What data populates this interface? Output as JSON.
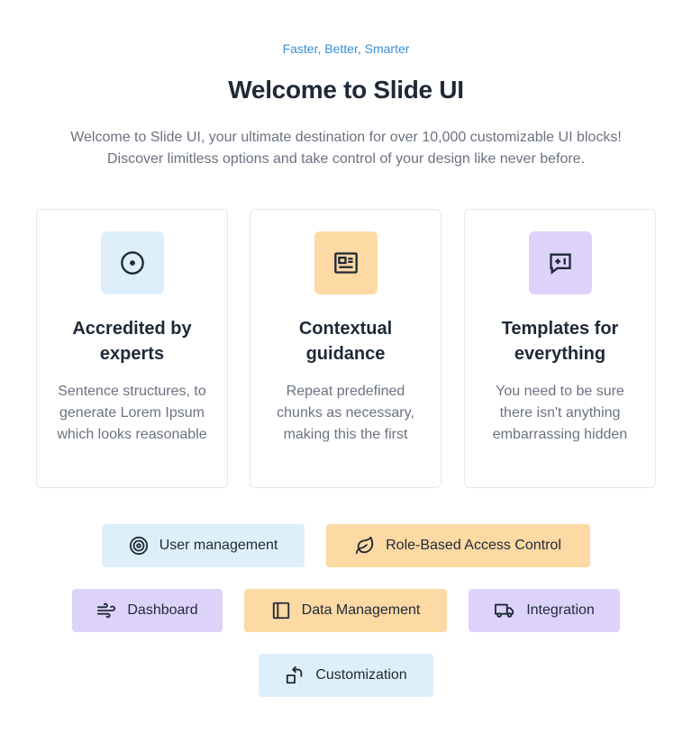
{
  "header": {
    "eyebrow": "Faster, Better, Smarter",
    "title": "Welcome to Slide UI",
    "intro": "Welcome to Slide UI, your ultimate destination for over 10,000 customizable UI blocks! Discover limitless options and take control of your design like never before."
  },
  "cards": [
    {
      "title": "Accredited by experts",
      "description": "Sentence structures, to generate Lorem Ipsum which looks reasonable",
      "icon": "target-circle-icon",
      "color": "#deeffc"
    },
    {
      "title": "Contextual guidance",
      "description": "Repeat predefined chunks as necessary, making this the first",
      "icon": "newspaper-icon",
      "color": "#fdd9a3"
    },
    {
      "title": "Templates for everything",
      "description": "You need to be sure there isn't anything embarrassing hidden",
      "icon": "message-plus-icon",
      "color": "#ddd3fa"
    }
  ],
  "features": [
    {
      "label": "User management",
      "icon": "target-icon"
    },
    {
      "label": "Role-Based Access Control",
      "icon": "leaf-icon"
    },
    {
      "label": "Dashboard",
      "icon": "wind-icon"
    },
    {
      "label": "Data Management",
      "icon": "sidebar-panel-icon"
    },
    {
      "label": "Integration",
      "icon": "truck-icon"
    },
    {
      "label": "Customization",
      "icon": "rotate-square-icon"
    }
  ],
  "colors": {
    "blue": "#deeffc",
    "orange": "#fdd9a3",
    "purple": "#ddd3fa",
    "accent": "#3b8fd6"
  }
}
